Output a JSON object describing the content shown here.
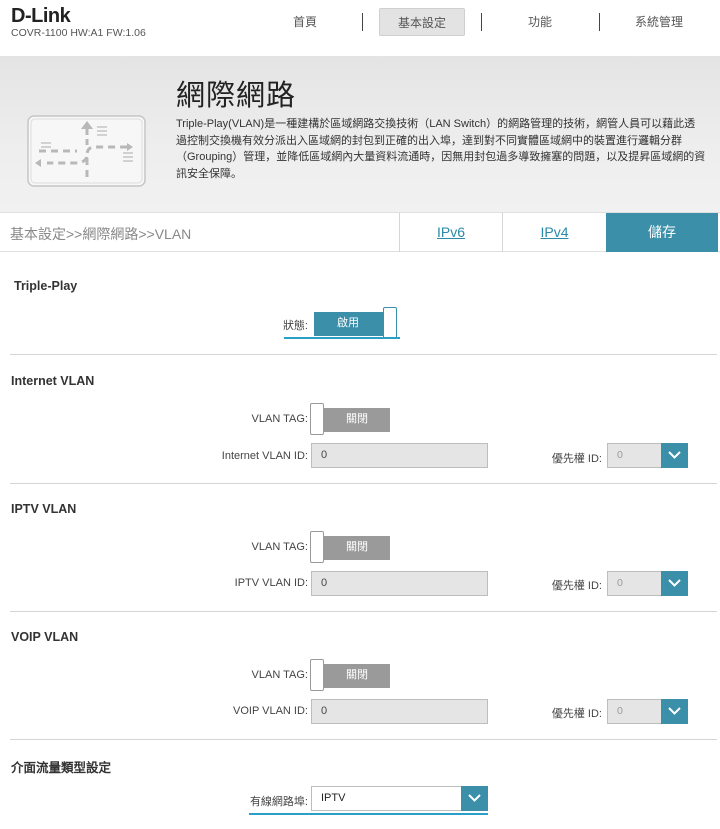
{
  "header": {
    "logo": "D-Link",
    "model": "COVR-1100 HW:A1 FW:1.06",
    "nav": [
      {
        "label": "首頁"
      },
      {
        "label": "基本設定"
      },
      {
        "label": "功能"
      },
      {
        "label": "系統管理"
      }
    ],
    "active_nav": "基本設定"
  },
  "banner": {
    "title": "網際網路",
    "description": "Triple-Play(VLAN)是一種建構於區域網路交換技術（LAN Switch）的網路管理的技術，網管人員可以藉此透過控制交換機有效分派出入區域網的封包到正確的出入埠，達到對不同實體區域網中的裝置進行邏輯分群（Grouping）管理，並降低區域網內大量資料流通時，因無用封包過多導致擁塞的問題，以及提昇區域網的資訊安全保障。",
    "icon": "network-switch-icon"
  },
  "toolbar": {
    "breadcrumb": "基本設定>>網際網路>>VLAN",
    "ipv6_label": "IPv6",
    "ipv4_label": "IPv4",
    "save_label": "儲存"
  },
  "triple_play": {
    "title": "Triple-Play",
    "status_label": "狀態:",
    "status_value": "啟用"
  },
  "internet_vlan": {
    "title": "Internet VLAN",
    "tag_label": "VLAN TAG:",
    "tag_value": "關閉",
    "id_label": "Internet VLAN ID:",
    "id_value": "0",
    "priority_label": "優先權 ID:",
    "priority_value": "0"
  },
  "iptv_vlan": {
    "title": "IPTV VLAN",
    "tag_label": "VLAN TAG:",
    "tag_value": "關閉",
    "id_label": "IPTV VLAN ID:",
    "id_value": "0",
    "priority_label": "優先權 ID:",
    "priority_value": "0"
  },
  "voip_vlan": {
    "title": "VOIP VLAN",
    "tag_label": "VLAN TAG:",
    "tag_value": "關閉",
    "id_label": "VOIP VLAN ID:",
    "id_value": "0",
    "priority_label": "優先權 ID:",
    "priority_value": "0"
  },
  "interface": {
    "title": "介面流量類型設定",
    "port_label": "有線網路埠:",
    "port_value": "IPTV"
  },
  "colors": {
    "accent": "#3b8fa8",
    "highlight": "#2a9fc9",
    "toggle_off": "#9a9a9a"
  }
}
